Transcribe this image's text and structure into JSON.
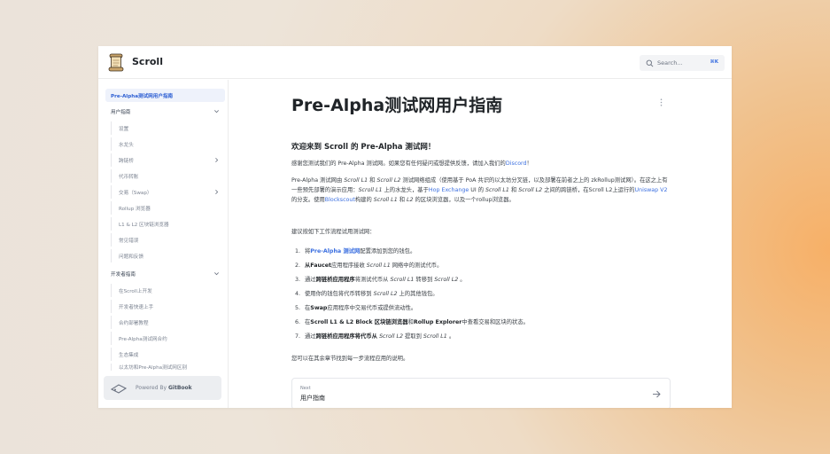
{
  "header": {
    "brand": "Scroll",
    "search_placeholder": "Search...",
    "search_shortcut": "⌘K"
  },
  "sidebar": {
    "items": [
      {
        "label": "Pre-Alpha测试网用户指南"
      },
      {
        "label": "用户指南"
      },
      {
        "label": "设置"
      },
      {
        "label": "水龙头"
      },
      {
        "label": "跨链桥"
      },
      {
        "label": "代币转账"
      },
      {
        "label": "交易（Swap）"
      },
      {
        "label": "Rollup 浏览器"
      },
      {
        "label": "L1 & L2 区块链浏览器"
      },
      {
        "label": "常见错误"
      },
      {
        "label": "问题和反馈"
      },
      {
        "label": "开发者指南"
      },
      {
        "label": "在Scroll上开发"
      },
      {
        "label": "开发者快速上手"
      },
      {
        "label": "合约部署教程"
      },
      {
        "label": "Pre-Alpha测试网合约"
      },
      {
        "label": "生态集成"
      },
      {
        "label": "以太坊和Pre-Alpha测试网区别"
      }
    ],
    "gitbook_prefix": "Powered By ",
    "gitbook_brand": "GitBook"
  },
  "main": {
    "title": "Pre-Alpha测试网用户指南",
    "heading": "欢迎来到 Scroll 的 Pre-Alpha 测试网！",
    "intro_text": "感谢您测试我们的 Pre-Alpha 测试网。如果您有任何疑问或想提供反馈，请加入我们的",
    "intro_link": "Discord",
    "intro_end": "！",
    "para2": {
      "t1": "Pre-Alpha 测试网由 ",
      "i1": "Scroll L1",
      "t2": " 和 ",
      "i2": "Scroll L2",
      "t3": " 测试网络组成（使用基于 PoA 共识的以太坊分叉链，以及部署在前者之上的 zkRollup测试网）。在这之上有一些预先部署的演示应用：",
      "i3": "Scroll L1",
      "t4": " 上的水龙头，基于",
      "a1": "Hop Exchange",
      "t5": " UI 的 ",
      "i4": "Scroll L1",
      "t6": " 和 ",
      "i5": "Scroll L2",
      "t7": " 之间的跨链桥，在Scroll L2上运行的",
      "a2": "Uniswap V2",
      "t8": "的分支。使用",
      "a3": "Blockscout",
      "t9": "构建的 ",
      "i6": "Scroll L1",
      "t10": " 和 ",
      "i7": "L2",
      "t11": " 的区块浏览器，以及一个rollup浏览器。"
    },
    "workflow_intro": "建议按如下工作流程试用测试网：",
    "steps": [
      {
        "n": "1.",
        "a": "将",
        "b": "Pre-Alpha 测试网",
        "c": "配置添加到您的钱包。"
      },
      {
        "n": "2.",
        "a": "从Faucet",
        "b": "应用程序接收 ",
        "c": "Scroll L1",
        "d": " 网络中的测试代币。"
      },
      {
        "n": "3.",
        "a": "通过",
        "b": "跨链桥应用程序",
        "c": "将测试代币从 ",
        "d": "Scroll L1",
        "e": " 转移到 ",
        "f": "Scroll L2",
        "g": " 。"
      },
      {
        "n": "4.",
        "a": "使用你的钱包将代币转移到 ",
        "b": "Scroll L2",
        "c": " 上的其他钱包。"
      },
      {
        "n": "5.",
        "a": "在",
        "b": "Swap",
        "c": "应用程序中交易代币或提供流动性。"
      },
      {
        "n": "6.",
        "a": "在",
        "b": "Scroll L1 & L2 Block 区块链浏览器",
        "c": "和",
        "d": "Rollup Explorer",
        "e": "中查看交易和区块的状态。"
      },
      {
        "n": "7.",
        "a": "通过",
        "b": "跨链桥应用程序将代币从 ",
        "c": "Scroll L2",
        "d": " 提取到 ",
        "e": "Scroll L1",
        "f": " 。"
      }
    ],
    "outro": "您可以在其余章节找到每一步流程应用的说明。",
    "next": {
      "small": "Next",
      "title": "用户指南"
    }
  }
}
